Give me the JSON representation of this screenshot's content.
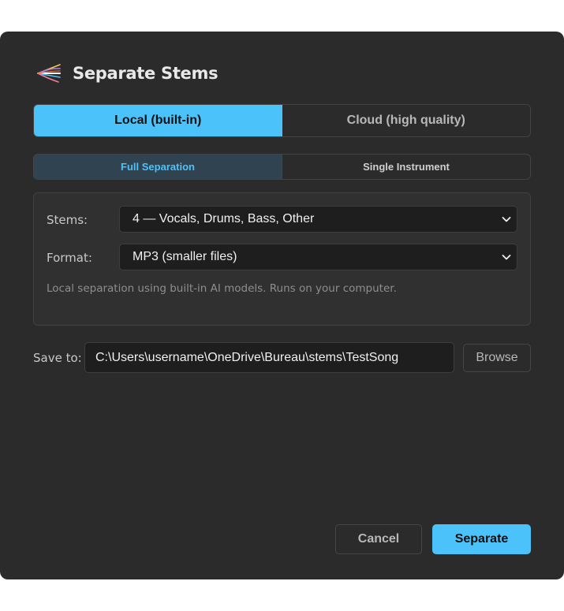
{
  "dialog": {
    "title": "Separate Stems",
    "logo_icon": "stems-fan-icon"
  },
  "mode_tabs": [
    {
      "label": "Local (built-in)",
      "active": true
    },
    {
      "label": "Cloud (high quality)",
      "active": false
    }
  ],
  "type_tabs": [
    {
      "label": "Full Separation",
      "active": true
    },
    {
      "label": "Single Instrument",
      "active": false
    }
  ],
  "options": {
    "stems_label": "Stems:",
    "stems_value": "4 — Vocals, Drums, Bass, Other",
    "format_label": "Format:",
    "format_value": "MP3 (smaller files)",
    "note": "Local separation using built-in AI models. Runs on your computer."
  },
  "save": {
    "label": "Save to:",
    "path": "C:\\Users\\username\\OneDrive\\Bureau\\stems\\TestSong",
    "browse_label": "Browse"
  },
  "actions": {
    "cancel_label": "Cancel",
    "confirm_label": "Separate"
  },
  "colors": {
    "accent": "#4cc2fb",
    "background": "#2b2b2b",
    "field": "#1e1e1e"
  }
}
